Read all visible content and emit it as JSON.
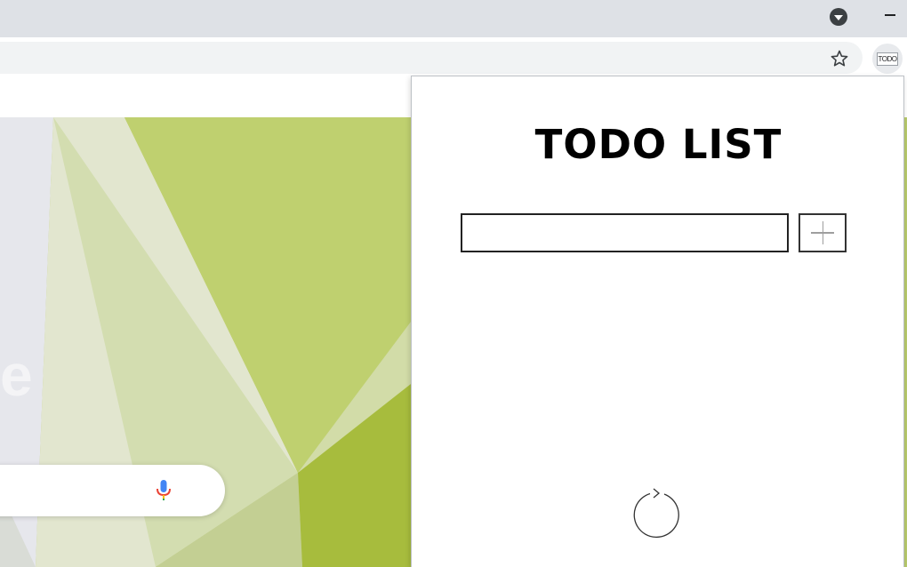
{
  "browser": {
    "extension_badge": "TODO",
    "icons": {
      "tab_menu": "chevron-down-icon",
      "minimize": "minimize-icon",
      "bookmark": "star-icon",
      "extension": "todo-extension-icon"
    }
  },
  "new_tab_page": {
    "logo_fragment": "e",
    "icons": {
      "voice": "microphone-icon"
    },
    "colors": {
      "background_green": "#b7c96a",
      "mic_blue": "#4285f4",
      "mic_red": "#ea4335"
    }
  },
  "popup": {
    "title": "TODO LIST",
    "input": {
      "value": "",
      "placeholder": ""
    },
    "icons": {
      "add": "plus-icon",
      "refresh": "refresh-icon"
    }
  }
}
